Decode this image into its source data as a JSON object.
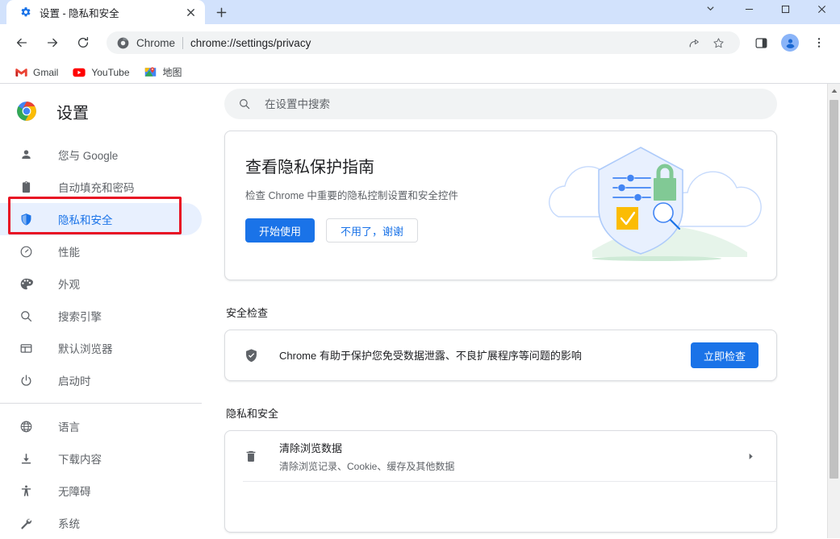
{
  "window": {
    "controls": {
      "tab_search": "tab-search",
      "minimize": "—",
      "maximize": "□",
      "close": "✕"
    }
  },
  "tabs": [
    {
      "title": "设置 - 隐私和安全",
      "favicon": "settings-gear-icon",
      "close": "✕",
      "active": true
    }
  ],
  "newtab_label": "+",
  "toolbar": {
    "back": "←",
    "forward": "→",
    "reload": "↻",
    "omnibox": {
      "icon": "chrome-logo-icon",
      "scheme_label": "Chrome",
      "url": "chrome://settings/privacy",
      "share": "share-icon",
      "bookmark": "star-icon"
    },
    "side_panel": "side-panel-icon",
    "profile": "profile-avatar",
    "menu": "⋮"
  },
  "bookmarks": [
    {
      "label": "Gmail",
      "icon": "gmail-icon"
    },
    {
      "label": "YouTube",
      "icon": "youtube-icon"
    },
    {
      "label": "地图",
      "icon": "maps-icon"
    }
  ],
  "sidebar": {
    "brand": "设置",
    "brand_icon": "chrome-logo-icon",
    "items": [
      {
        "label": "您与 Google",
        "icon": "person-icon",
        "selected": false
      },
      {
        "label": "自动填充和密码",
        "icon": "clipboard-icon",
        "selected": false
      },
      {
        "label": "隐私和安全",
        "icon": "shield-icon",
        "selected": true
      },
      {
        "label": "性能",
        "icon": "speedometer-icon",
        "selected": false
      },
      {
        "label": "外观",
        "icon": "palette-icon",
        "selected": false
      },
      {
        "label": "搜索引擎",
        "icon": "search-icon",
        "selected": false
      },
      {
        "label": "默认浏览器",
        "icon": "browser-window-icon",
        "selected": false
      },
      {
        "label": "启动时",
        "icon": "power-icon",
        "selected": false
      }
    ],
    "items2": [
      {
        "label": "语言",
        "icon": "globe-icon"
      },
      {
        "label": "下载内容",
        "icon": "download-icon"
      },
      {
        "label": "无障碍",
        "icon": "accessibility-icon"
      },
      {
        "label": "系统",
        "icon": "wrench-icon"
      }
    ]
  },
  "search": {
    "placeholder": "在设置中搜索",
    "value": "",
    "icon": "search-icon"
  },
  "promo": {
    "title": "查看隐私保护指南",
    "subtitle": "检查 Chrome 中重要的隐私控制设置和安全控件",
    "primary_button": "开始使用",
    "secondary_button": "不用了，谢谢",
    "illustration": "privacy-shield-illustration"
  },
  "safety_check": {
    "section_title": "安全检查",
    "description": "Chrome 有助于保护您免受数据泄露、不良扩展程序等问题的影响",
    "button": "立即检查",
    "icon": "shield-check-icon"
  },
  "privacy_section": {
    "section_title": "隐私和安全",
    "rows": [
      {
        "title": "清除浏览数据",
        "subtitle": "清除浏览记录、Cookie、缓存及其他数据",
        "icon": "trash-icon",
        "arrow": "▸"
      }
    ]
  },
  "colors": {
    "accent": "#1a73e8",
    "selected_bg": "#e8f0fe",
    "highlight_box": "#e81123",
    "tabstrip_bg": "#d2e2fc",
    "avatar": "#8ab4f8"
  },
  "scrollbar": {
    "up_arrow": "▲"
  }
}
